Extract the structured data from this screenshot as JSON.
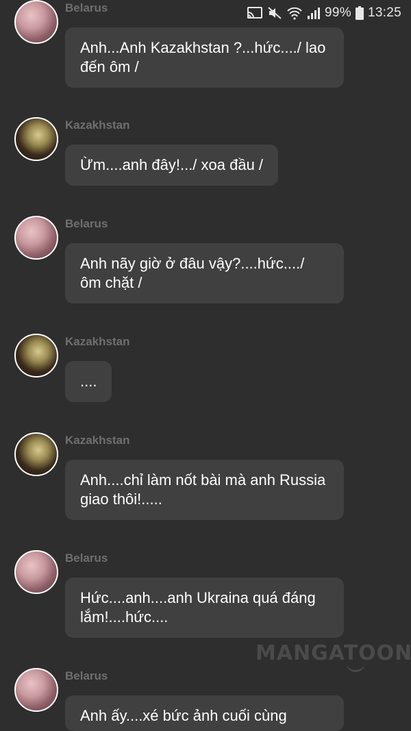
{
  "status_bar": {
    "battery": "99%",
    "time": "13:25",
    "icons": [
      "cast-icon",
      "mute-icon",
      "wifi-icon",
      "signal-icon",
      "battery-icon"
    ]
  },
  "messages": [
    {
      "sender": "Belarus",
      "text": "Anh...Anh Kazakhstan ?...hức..../ lao đến ôm /"
    },
    {
      "sender": "Kazakhstan",
      "text": "Ừm....anh đây!.../ xoa đầu /"
    },
    {
      "sender": "Belarus",
      "text": "Anh nãy giờ ở đâu vậy?....hức..../ ôm chặt /"
    },
    {
      "sender": "Kazakhstan",
      "text": "...."
    },
    {
      "sender": "Kazakhstan",
      "text": "Anh....chỉ làm nốt bài mà anh Russia giao thôi!....."
    },
    {
      "sender": "Belarus",
      "text": "Hức....anh....anh Ukraina quá đáng lắm!....hức...."
    },
    {
      "sender": "Belarus",
      "text": "Anh ấy....xé bức ảnh cuối cùng"
    }
  ],
  "watermark": "MANGATOON",
  "colors": {
    "background": "#2e2e2e",
    "bubble": "#404040",
    "sender_name": "#6f6f6f",
    "text": "#ffffff"
  }
}
